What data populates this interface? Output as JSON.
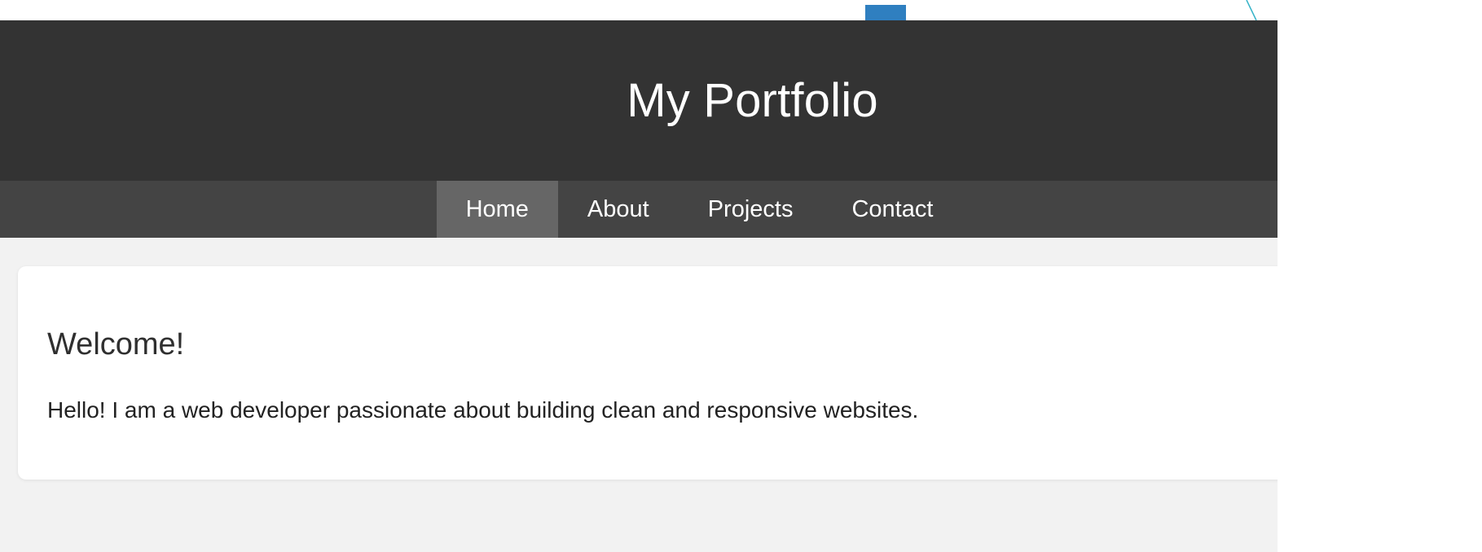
{
  "site": {
    "title": "My Portfolio"
  },
  "nav": {
    "items": [
      {
        "label": "Home",
        "active": true
      },
      {
        "label": "About",
        "active": false
      },
      {
        "label": "Projects",
        "active": false
      },
      {
        "label": "Contact",
        "active": false
      }
    ]
  },
  "main": {
    "heading": "Welcome!",
    "intro": "Hello! I am a web developer passionate about building clean and responsive websites."
  },
  "colors": {
    "header_bg": "#333333",
    "nav_bg": "#444444",
    "nav_active_bg": "#666666",
    "page_bg": "#f2f2f2",
    "card_bg": "#ffffff",
    "accent_marker": "#2f7fc0"
  }
}
